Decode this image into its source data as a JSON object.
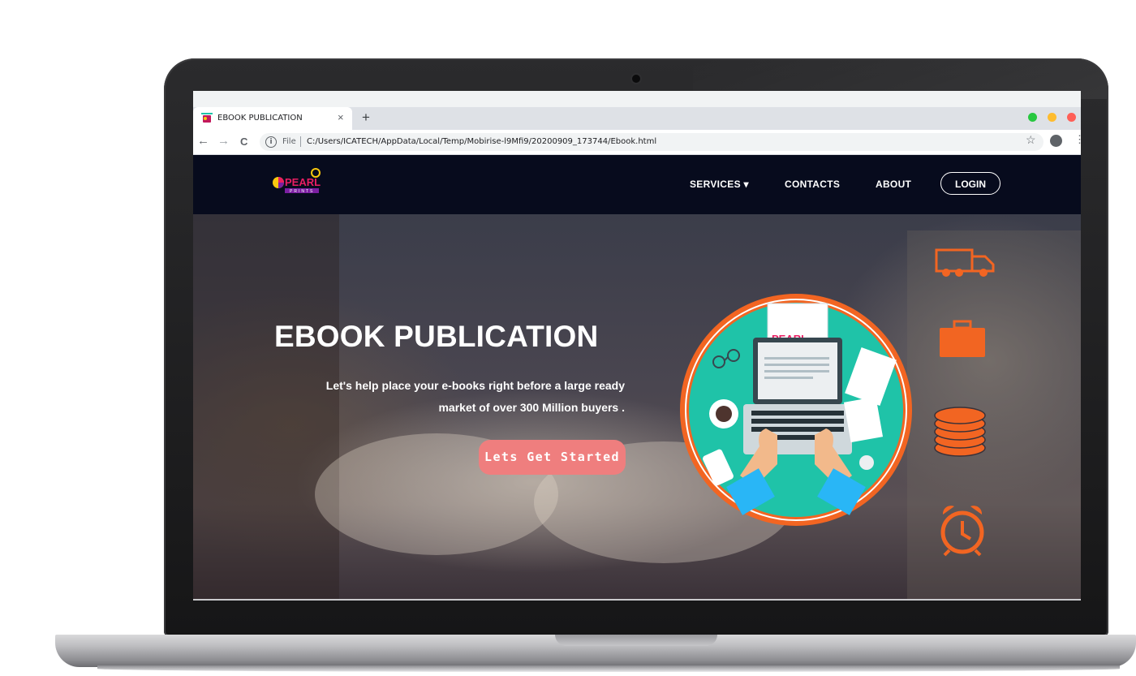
{
  "browser": {
    "tab_title": "EBOOK PUBLICATION",
    "tab_close": "×",
    "new_tab": "+",
    "back": "←",
    "forward": "→",
    "reload": "C",
    "info": "i",
    "scheme": "File",
    "url": "C:/Users/ICATECH/AppData/Local/Temp/Mobirise-l9Mfi9/20200909_173744/Ebook.html",
    "star": "☆",
    "menu": "⋮",
    "window_controls": {
      "green": "#28c840",
      "yellow": "#febc2e",
      "red": "#ff5f57"
    }
  },
  "site": {
    "logo_text": "PEARL",
    "logo_sub": "PRINTS",
    "nav": {
      "services": "SERVICES",
      "services_caret": "▾",
      "contacts": "CONTACTS",
      "about": "ABOUT",
      "login": "LOGIN"
    }
  },
  "hero": {
    "title": "EBOOK PUBLICATION",
    "subtitle_line1": "Let's help place your e-books right before a large ready",
    "subtitle_line2": "market of over 300 Million buyers .",
    "cta": "Lets Get Started",
    "illustration_logo": "PEARL",
    "side_icons": [
      "delivery-truck-icon",
      "briefcase-icon",
      "coin-stack-icon",
      "alarm-clock-icon"
    ]
  },
  "colors": {
    "nav_bg": "#070b1d",
    "cta_bg": "#ef7e7e",
    "accent_orange": "#f26522",
    "teal": "#1fc3a8"
  }
}
